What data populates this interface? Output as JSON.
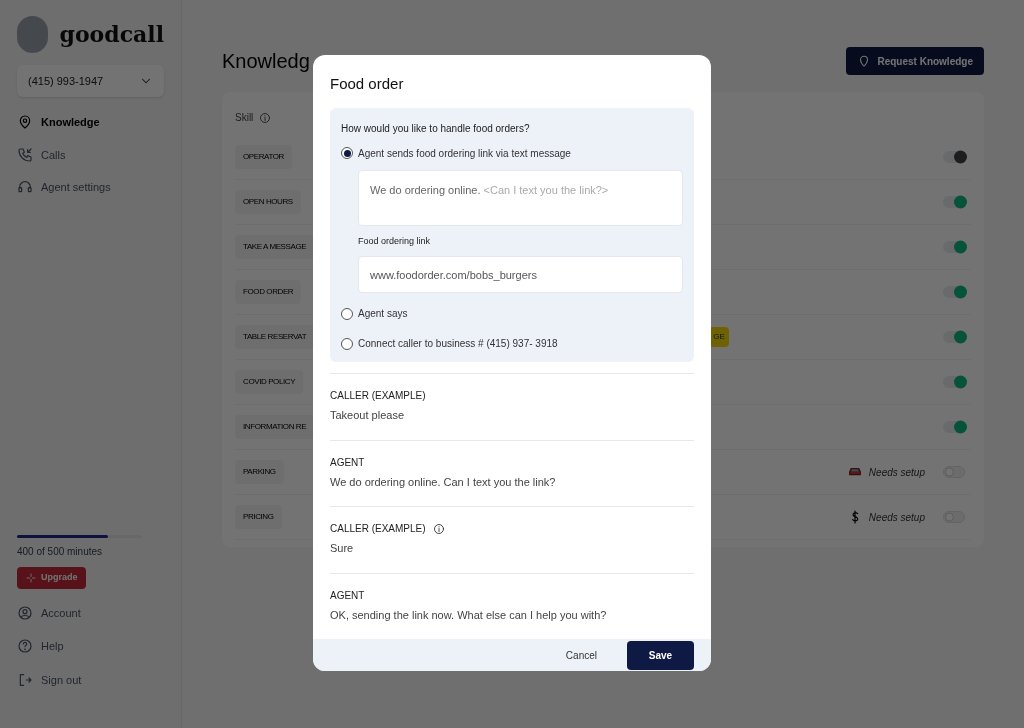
{
  "sidebar": {
    "brand": "goodcall",
    "phone": "(415) 993-1947",
    "nav": [
      {
        "label": "Knowledge",
        "selected": true
      },
      {
        "label": "Calls",
        "selected": false
      },
      {
        "label": "Agent settings",
        "selected": false
      }
    ],
    "usage": {
      "level": 0.73,
      "text": "400 of 500 minutes"
    },
    "upgrade": "Upgrade",
    "footer": [
      {
        "label": "Account"
      },
      {
        "label": "Help"
      },
      {
        "label": "Sign out"
      }
    ]
  },
  "main": {
    "title": "Knowledg",
    "request_button": "Request Knowledge",
    "column": "Skill",
    "skills": [
      {
        "label": "OPERATOR",
        "on": true,
        "disabled": true
      },
      {
        "label": "OPEN HOURS",
        "on": true,
        "disabled": false
      },
      {
        "label": "TAKE A MESSAGE",
        "on": true,
        "disabled": false
      },
      {
        "label": "FOOD ORDER",
        "on": true,
        "disabled": false
      },
      {
        "label": "TABLE RESERVAT",
        "on": true,
        "disabled": false,
        "badge": "GE"
      },
      {
        "label": "COVID POLICY",
        "on": true,
        "disabled": false
      },
      {
        "label": "INFORMATION RE",
        "on": true,
        "disabled": false
      },
      {
        "label": "PARKING",
        "on": false,
        "note": "Needs setup"
      },
      {
        "label": "PRICING",
        "on": false,
        "note": "Needs setup"
      }
    ]
  },
  "dialog": {
    "title": "Food order",
    "question": "How would you like to handle food orders?",
    "options": [
      {
        "label": "Agent sends food ordering link via text message",
        "selected": true
      },
      {
        "label": "Agent says",
        "selected": false
      },
      {
        "label": "Connect caller to business # (415) 937- 3918",
        "selected": false
      }
    ],
    "message_text": "We do ordering online.",
    "message_hint": "<Can I text you the link?>",
    "link_label": "Food ordering link",
    "link_value": "www.foodorder.com/bobs_burgers",
    "conversation": [
      {
        "speaker": "CALLER (EXAMPLE)",
        "text": "Takeout please",
        "info": false
      },
      {
        "speaker": "AGENT",
        "text": "We do ordering online. Can I text you the link?",
        "info": false
      },
      {
        "speaker": "CALLER (EXAMPLE)",
        "text": "Sure",
        "info": true
      },
      {
        "speaker": "AGENT",
        "text": "OK, sending the link now. What else can I help you with?",
        "info": false
      }
    ],
    "cancel": "Cancel",
    "save": "Save"
  }
}
